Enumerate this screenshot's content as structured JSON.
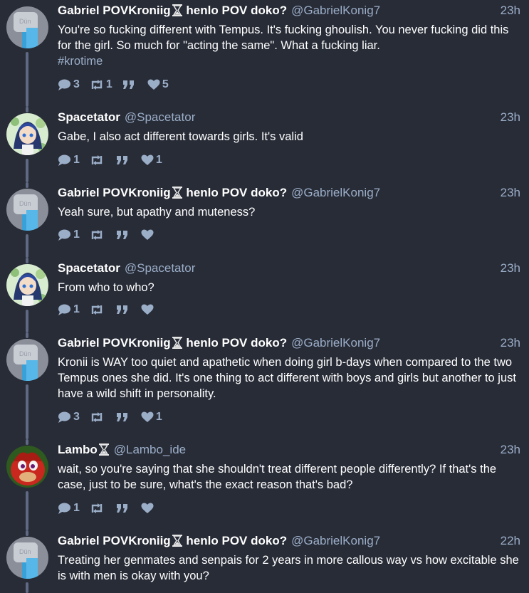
{
  "posts": [
    {
      "display_name": "Gabriel POVKroniig",
      "name_suffix": " henlo POV doko?",
      "handle": "@GabrielKonig7",
      "time": "23h",
      "text": "You're so fucking different with Tempus. It's fucking ghoulish. You never fucking did this for the girl. So much for \"acting the same\". What a fucking liar.",
      "hashtag": "#krotime",
      "replies": "3",
      "boosts": "1",
      "quotes": "",
      "favourites": "5",
      "avatar": "gabriel-avatar"
    },
    {
      "display_name": "Spacetator",
      "name_suffix": "",
      "handle": "@Spacetator",
      "time": "23h",
      "text": "Gabe, I also act different towards girls. It's valid",
      "replies": "1",
      "boosts": "",
      "quotes": "",
      "favourites": "1",
      "avatar": "spacetator-avatar"
    },
    {
      "display_name": "Gabriel POVKroniig",
      "name_suffix": " henlo POV doko?",
      "handle": "@GabrielKonig7",
      "time": "23h",
      "text": "Yeah sure, but apathy and muteness?",
      "replies": "1",
      "boosts": "",
      "quotes": "",
      "favourites": "",
      "avatar": "gabriel-avatar"
    },
    {
      "display_name": "Spacetator",
      "name_suffix": "",
      "handle": "@Spacetator",
      "time": "23h",
      "text": "From who to who?",
      "replies": "1",
      "boosts": "",
      "quotes": "",
      "favourites": "",
      "avatar": "spacetator-avatar"
    },
    {
      "display_name": "Gabriel POVKroniig",
      "name_suffix": " henlo POV doko?",
      "handle": "@GabrielKonig7",
      "time": "23h",
      "text": "Kronii is WAY too quiet and apathetic when doing girl b-days when compared to the two Tempus ones she did. It's one thing to act different with boys and girls but another to just have a wild shift in personality.",
      "replies": "3",
      "boosts": "",
      "quotes": "",
      "favourites": "1",
      "avatar": "gabriel-avatar"
    },
    {
      "display_name": "Lambo",
      "name_suffix": "",
      "handle": "@Lambo_ide",
      "time": "23h",
      "text": "wait, so you're saying that she shouldn't treat different people differently? If that's the case, just to be sure, what's the exact reason that's bad?",
      "replies": "1",
      "boosts": "",
      "quotes": "",
      "favourites": "",
      "avatar": "lambo-avatar"
    },
    {
      "display_name": "Gabriel POVKroniig",
      "name_suffix": " henlo POV doko?",
      "handle": "@GabrielKonig7",
      "time": "22h",
      "text": "Treating her genmates and senpais for 2 years in more callous way vs how excitable she is with men is okay with you?",
      "replies": "",
      "boosts": "",
      "quotes": "",
      "favourites": "",
      "avatar": "gabriel-avatar"
    }
  ],
  "colors": {
    "background": "#282c37",
    "name": "#ffffff",
    "muted": "#9baec8",
    "thread_line": "#606984"
  },
  "icons": [
    "reply-icon",
    "boost-icon",
    "quote-icon",
    "favourite-icon",
    "hourglass-icon"
  ]
}
